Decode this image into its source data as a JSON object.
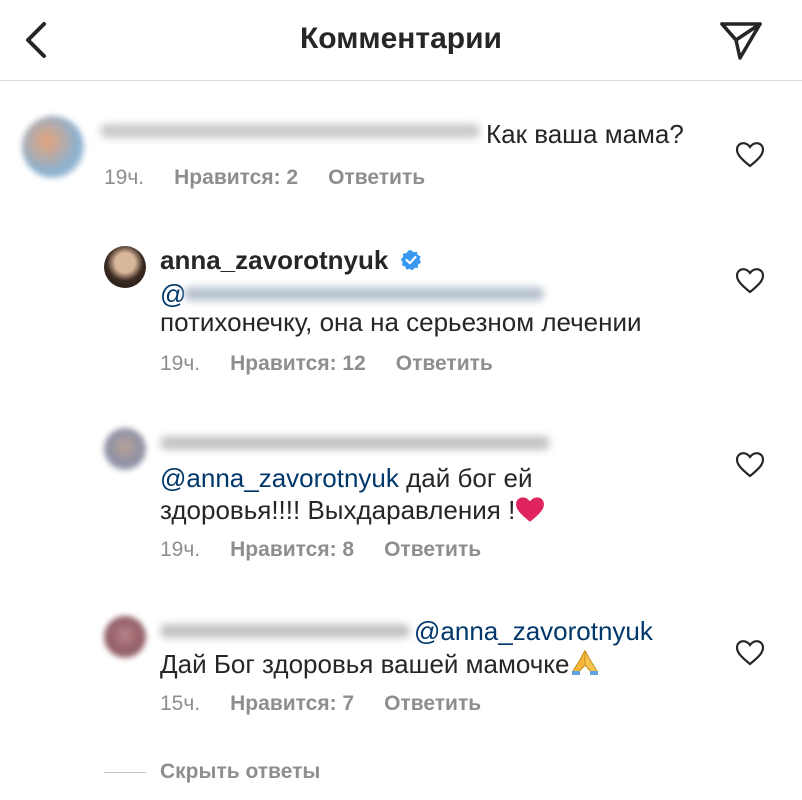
{
  "header": {
    "title": "Комментарии",
    "back_icon": "chevron-left-icon",
    "share_icon": "paper-plane-icon"
  },
  "comments": [
    {
      "username": "",
      "text": "Как ваша мама?",
      "time": "19ч.",
      "likes": "Нравится: 2",
      "reply": "Ответить"
    },
    {
      "username": "anna_zavorotnyuk",
      "verified": true,
      "mention_prefix": "@",
      "text": "потихонечку, она на серьезном лечении",
      "time": "19ч.",
      "likes": "Нравится: 12",
      "reply": "Ответить"
    },
    {
      "username": "",
      "mention": "@anna_zavorotnyuk",
      "text_line1": "дай бог ей",
      "text_line2": "здоровья!!!! Выхдаравления !",
      "emoji": "❤️",
      "time": "19ч.",
      "likes": "Нравится: 8",
      "reply": "Ответить"
    },
    {
      "username": "",
      "mention": "@anna_zavorotnyuk",
      "text": "Дай Бог здоровья вашей мамочке",
      "emoji": "🙏",
      "time": "15ч.",
      "likes": "Нравится: 7",
      "reply": "Ответить"
    }
  ],
  "hide_replies": "Скрыть ответы",
  "colors": {
    "text": "#262626",
    "meta": "#8e8e8e",
    "mention": "#00376b",
    "verified": "#3897f0",
    "heart_emoji": "#e0245e"
  }
}
